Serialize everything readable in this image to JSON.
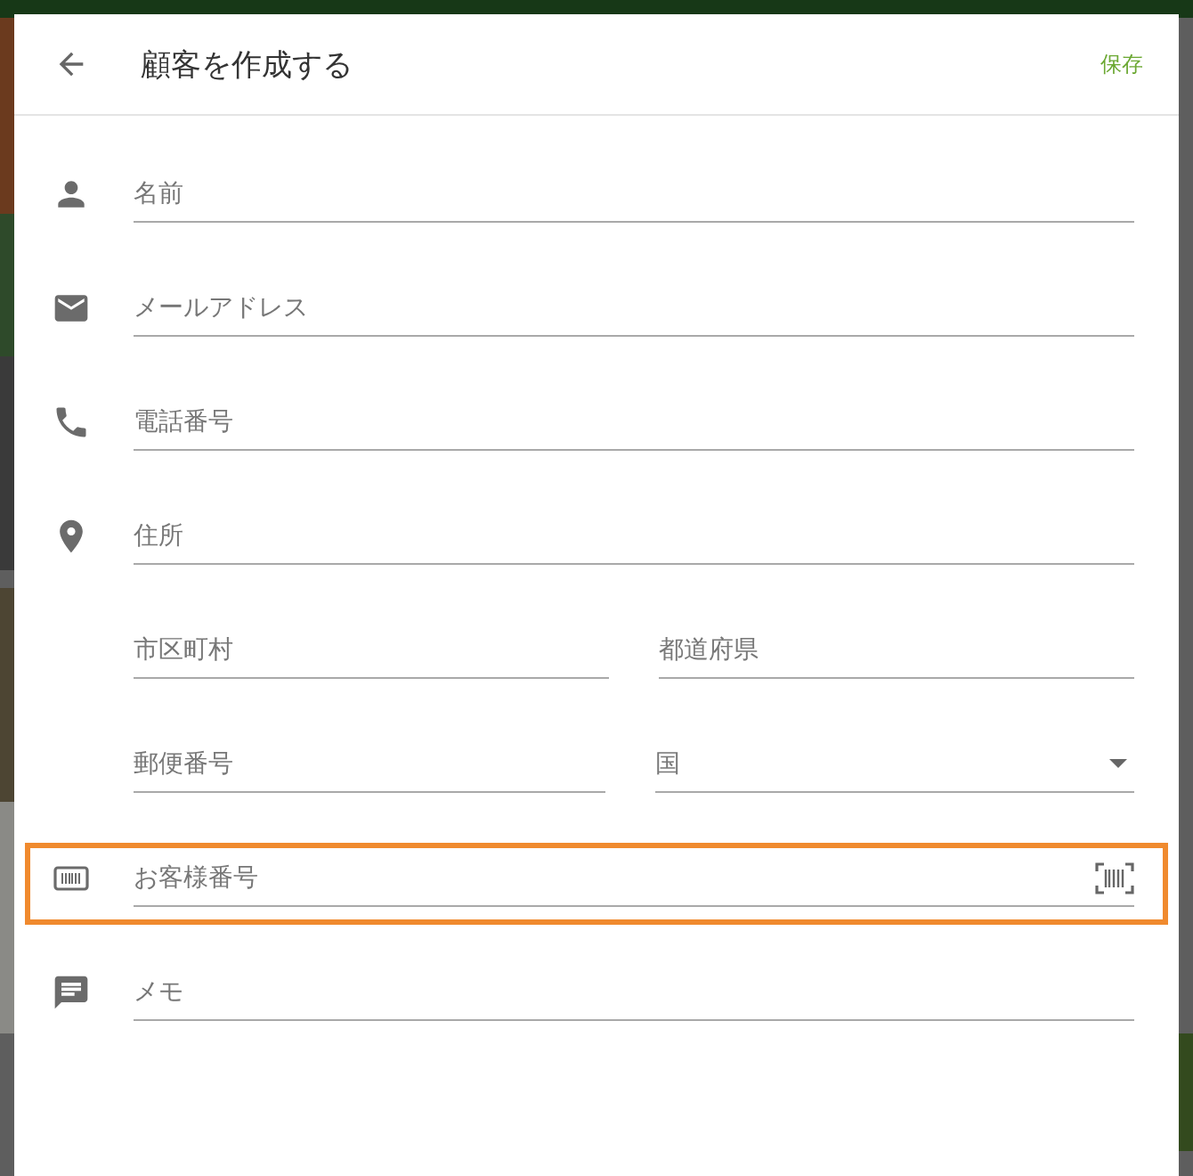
{
  "dialog": {
    "title": "顧客を作成する",
    "action": "保存"
  },
  "rows": [
    {
      "highlighted": false,
      "fields": [
        {
          "kind": "text",
          "placeholder": "名前"
        }
      ]
    },
    {
      "highlighted": false,
      "fields": [
        {
          "kind": "text",
          "placeholder": "メールアドレス"
        }
      ]
    },
    {
      "highlighted": false,
      "fields": [
        {
          "kind": "text",
          "placeholder": "電話番号"
        }
      ]
    },
    {
      "highlighted": false,
      "fields": [
        {
          "kind": "text",
          "placeholder": "住所"
        }
      ]
    },
    {
      "highlighted": false,
      "fields": [
        {
          "kind": "text",
          "placeholder": "市区町村"
        },
        {
          "kind": "text",
          "placeholder": "都道府県"
        }
      ]
    },
    {
      "highlighted": false,
      "fields": [
        {
          "kind": "text",
          "placeholder": "郵便番号"
        },
        {
          "kind": "select",
          "placeholder": "国"
        }
      ]
    },
    {
      "highlighted": true,
      "fields": [
        {
          "kind": "scan",
          "placeholder": "お客様番号"
        }
      ]
    },
    {
      "highlighted": false,
      "fields": [
        {
          "kind": "text",
          "placeholder": "メモ"
        }
      ]
    }
  ]
}
